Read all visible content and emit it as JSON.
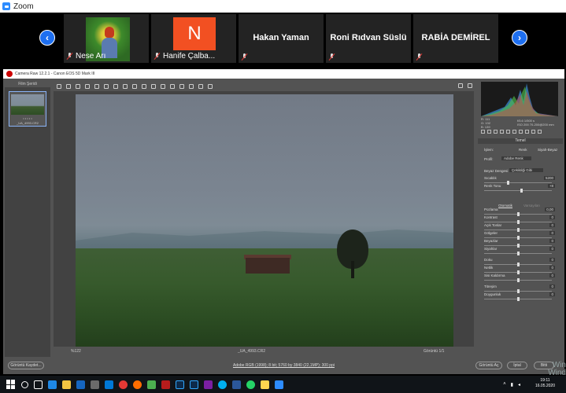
{
  "zoom": {
    "title": "Zoom",
    "participants": [
      {
        "name": "Nese Arı",
        "type": "photo"
      },
      {
        "name": "Hanife Çalba...",
        "type": "avatar",
        "initial": "N",
        "color": "#f25022"
      },
      {
        "name": "Hakan Yaman",
        "type": "name"
      },
      {
        "name": "Roni Rıdvan Süslü",
        "type": "name"
      },
      {
        "name": "RABİA DEMİREL",
        "type": "name"
      }
    ],
    "prev_icon": "chevron-left-icon",
    "next_icon": "chevron-right-icon"
  },
  "camera_raw": {
    "titlebar": "Camera Raw 12.2.1 - Canon EOS 5D Mark III",
    "filmstrip_title": "Film Şeridi",
    "thumb_stars": "• • • • •",
    "thumb_label": "_UA_4993.CR2",
    "zoom_level": "%122",
    "filename": "_UA_4993.CR2",
    "counter": "Görüntü 1/1",
    "histogram_info": {
      "rgb": [
        "R: 111",
        "G: 132",
        "B: 139"
      ],
      "exposure": [
        "f/5.6  1/500 s",
        "ISO 200  70-200@200 mm"
      ]
    },
    "panel_title": "Temel",
    "treatment_label": "İşlem:",
    "treatment_color": "Renk",
    "treatment_bw": "Siyah-Beyaz",
    "profile_label": "Profil:",
    "profile_value": "Adobe Renk",
    "wb_label": "Beyaz Dengesi:",
    "wb_value": "Çekildiği Gibi",
    "sliders": [
      {
        "label": "Sıcaklık",
        "value": "5200",
        "pos": 0.35
      },
      {
        "label": "Renk Tonu",
        "value": "+8",
        "pos": 0.55
      },
      {
        "label": "Pozlama",
        "value": "0,00",
        "pos": 0.5
      },
      {
        "label": "Kontrast",
        "value": "0",
        "pos": 0.5
      },
      {
        "label": "Açık Tonlar",
        "value": "0",
        "pos": 0.5
      },
      {
        "label": "Gölgeler",
        "value": "0",
        "pos": 0.5
      },
      {
        "label": "Beyazlar",
        "value": "0",
        "pos": 0.5
      },
      {
        "label": "Siyahlar",
        "value": "0",
        "pos": 0.5
      },
      {
        "label": "Doku",
        "value": "0",
        "pos": 0.5
      },
      {
        "label": "Netlik",
        "value": "0",
        "pos": 0.5
      },
      {
        "label": "Sisi Kaldırma",
        "value": "0",
        "pos": 0.5
      },
      {
        "label": "Titreşim",
        "value": "0",
        "pos": 0.5
      },
      {
        "label": "Doygunluk",
        "value": "0",
        "pos": 0.5
      }
    ],
    "auto_label": "Otomatik",
    "default_label": "Varsayılan",
    "save_button": "Görüntü Kaydet...",
    "footer_info": "Adobe RGB (1998); 8 bit; 5760 by 3840 (22,1MP); 300 ppi",
    "open_button": "Görüntü Aç",
    "cancel_button": "İptal",
    "done_button": "Bitti"
  },
  "watermark": [
    "Win",
    "Wind"
  ],
  "taskbar": {
    "time": "19:11",
    "date": "16.05.2020"
  },
  "colors": {
    "zoom_blue": "#2d8cff",
    "mute_red": "#e53935",
    "ps_bg": "#535353"
  }
}
